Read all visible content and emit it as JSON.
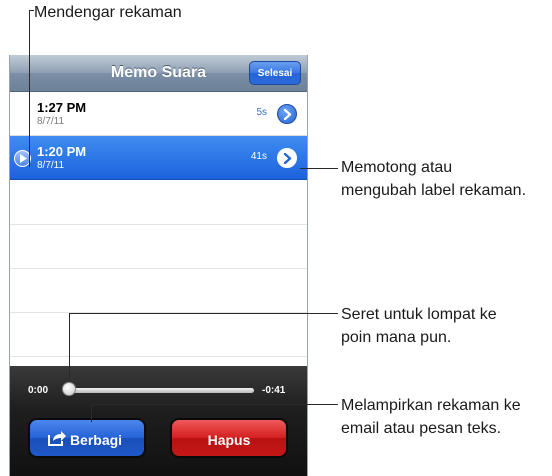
{
  "callouts": {
    "listen": "Mendengar rekaman",
    "trim_line1": "Memotong atau",
    "trim_line2": "mengubah label rekaman.",
    "scrub_line1": "Seret untuk lompat ke",
    "scrub_line2": "poin mana pun.",
    "attach_line1": "Melampirkan rekaman ke",
    "attach_line2": "email atau pesan teks."
  },
  "navbar": {
    "title": "Memo Suara",
    "done_label": "Selesai"
  },
  "recordings": [
    {
      "time": "1:27 PM",
      "date": "8/7/11",
      "duration": "5s",
      "selected": false
    },
    {
      "time": "1:20 PM",
      "date": "8/7/11",
      "duration": "41s",
      "selected": true
    }
  ],
  "player": {
    "elapsed": "0:00",
    "remaining": "-0:41",
    "progress": 0.0,
    "share_label": "Berbagi",
    "delete_label": "Hapus"
  },
  "colors": {
    "selected_row": "#1c62dc",
    "share_button": "#2462d6",
    "delete_button": "#d41e1e"
  },
  "icons": [
    "play-icon",
    "disclosure-arrow-icon",
    "share-icon"
  ]
}
